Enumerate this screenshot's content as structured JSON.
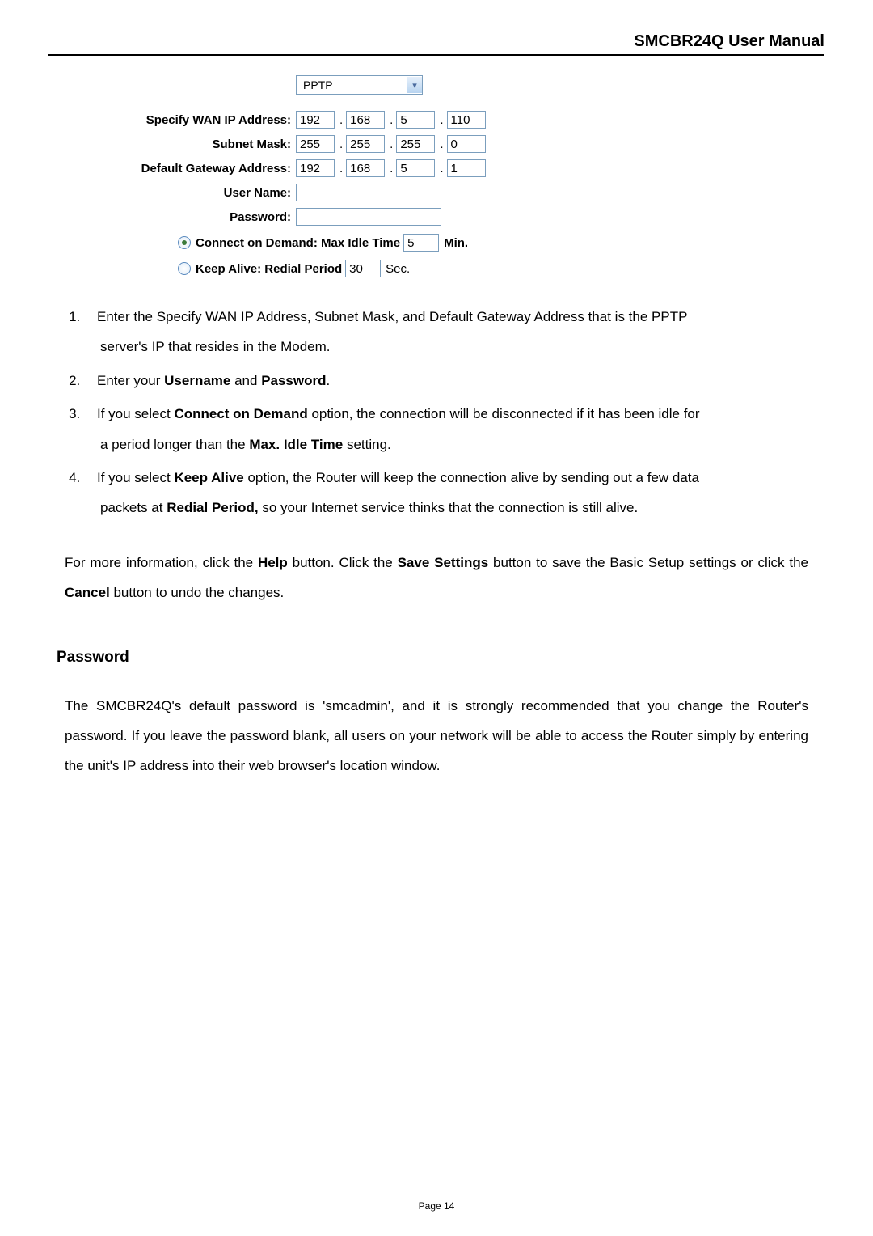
{
  "header": {
    "title": "SMCBR24Q User Manual"
  },
  "form": {
    "protocol_selected": "PPTP",
    "wan_ip": {
      "label": "Specify WAN IP Address:",
      "o1": "192",
      "o2": "168",
      "o3": "5",
      "o4": "110"
    },
    "subnet": {
      "label": "Subnet Mask:",
      "o1": "255",
      "o2": "255",
      "o3": "255",
      "o4": "0"
    },
    "gateway": {
      "label": "Default Gateway Address:",
      "o1": "192",
      "o2": "168",
      "o3": "5",
      "o4": "1"
    },
    "username_label": "User Name:",
    "password_label": "Password:",
    "connect_on_demand": {
      "label": "Connect on Demand: Max Idle Time",
      "value": "5",
      "unit": "Min."
    },
    "keep_alive": {
      "label": "Keep Alive: Redial Period",
      "value": "30",
      "unit": "Sec."
    }
  },
  "steps": {
    "s1a": "Enter the Specify WAN IP Address, Subnet Mask, and Default Gateway Address that is the PPTP",
    "s1b": "server's IP that resides in the Modem.",
    "s2a": "Enter your ",
    "s2b": "Username",
    "s2c": " and ",
    "s2d": "Password",
    "s2e": ".",
    "s3a": "If you select ",
    "s3b": "Connect on Demand",
    "s3c": " option, the connection will be disconnected if it has been idle for",
    "s3d": "a period longer than the ",
    "s3e": "Max. Idle Time",
    "s3f": " setting.",
    "s4a": "If you select ",
    "s4b": "Keep Alive",
    "s4c": " option, the Router will keep the connection alive by sending out a few data",
    "s4d": "packets at ",
    "s4e": "Redial Period,",
    "s4f": " so your Internet service thinks that the connection is still alive."
  },
  "para": {
    "p1a": "For more information, click the ",
    "p1b": "Help",
    "p1c": " button. Click the ",
    "p1d": "Save Settings",
    "p1e": " button to save the Basic Setup settings or click the ",
    "p1f": "Cancel",
    "p1g": " button to undo the changes."
  },
  "password_section": {
    "heading": "Password",
    "body": "The SMCBR24Q's default password is 'smcadmin', and it is strongly recommended that you change the Router's password. If you leave the password blank, all users on your network will be able to access the Router simply by entering the unit's IP address into their web browser's location window."
  },
  "footer": "Page 14"
}
